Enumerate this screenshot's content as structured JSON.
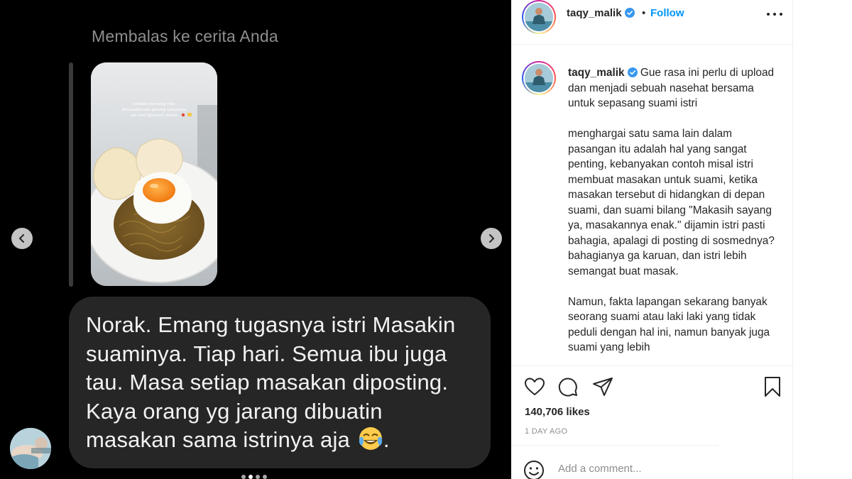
{
  "story_reply": {
    "label": "Membalas ke cerita Anda",
    "message": "Norak. Emang tugasnya istri Masakin suaminya. Tiap hari. Semua ibu juga tau. Masa setiap masakan diposting. Kaya orang yg jarang dibuatin masakan sama istrinya aja",
    "message_end": ".",
    "story_caption_lines": [
      "sehabis morning ride",
      "dimasakin mie goreng lemonade",
      "ala chef @sheryl_shahh"
    ]
  },
  "carousel": {
    "total_slides": 4,
    "active_slide": 2
  },
  "post": {
    "username": "taqy_malik",
    "follow_label": "Follow",
    "separator": "•",
    "caption_paragraphs": [
      "Gue rasa ini perlu di upload dan menjadi sebuah nasehat bersama untuk sepasang suami istri",
      "menghargai satu sama lain dalam pasangan itu adalah hal yang sangat penting, kebanyakan contoh misal istri membuat masakan untuk suami, ketika masakan tersebut di hidangkan di depan suami, dan suami bilang \"Makasih sayang ya, masakannya enak.\" dijamin istri pasti bahagia, apalagi di posting di sosmednya? bahagianya ga karuan, dan istri lebih semangat buat masak.",
      "Namun, fakta lapangan sekarang banyak seorang suami atau laki laki yang tidak peduli dengan hal ini, namun banyak juga suami yang lebih"
    ],
    "likes": "140,706 likes",
    "date": "1 DAY AGO",
    "comment_placeholder": "Add a comment..."
  },
  "icons": {
    "like": "heart-icon",
    "comment": "comment-bubble-icon",
    "share": "paper-plane-icon",
    "save": "bookmark-icon",
    "emoji": "smiley-icon",
    "verified": "verified-badge-icon",
    "more": "more-options-icon",
    "prev": "chevron-left-icon",
    "next": "chevron-right-icon"
  },
  "colors": {
    "accent": "#0095f6",
    "verified": "#3897f0",
    "bubble": "#262626",
    "media_bg": "#000000"
  }
}
